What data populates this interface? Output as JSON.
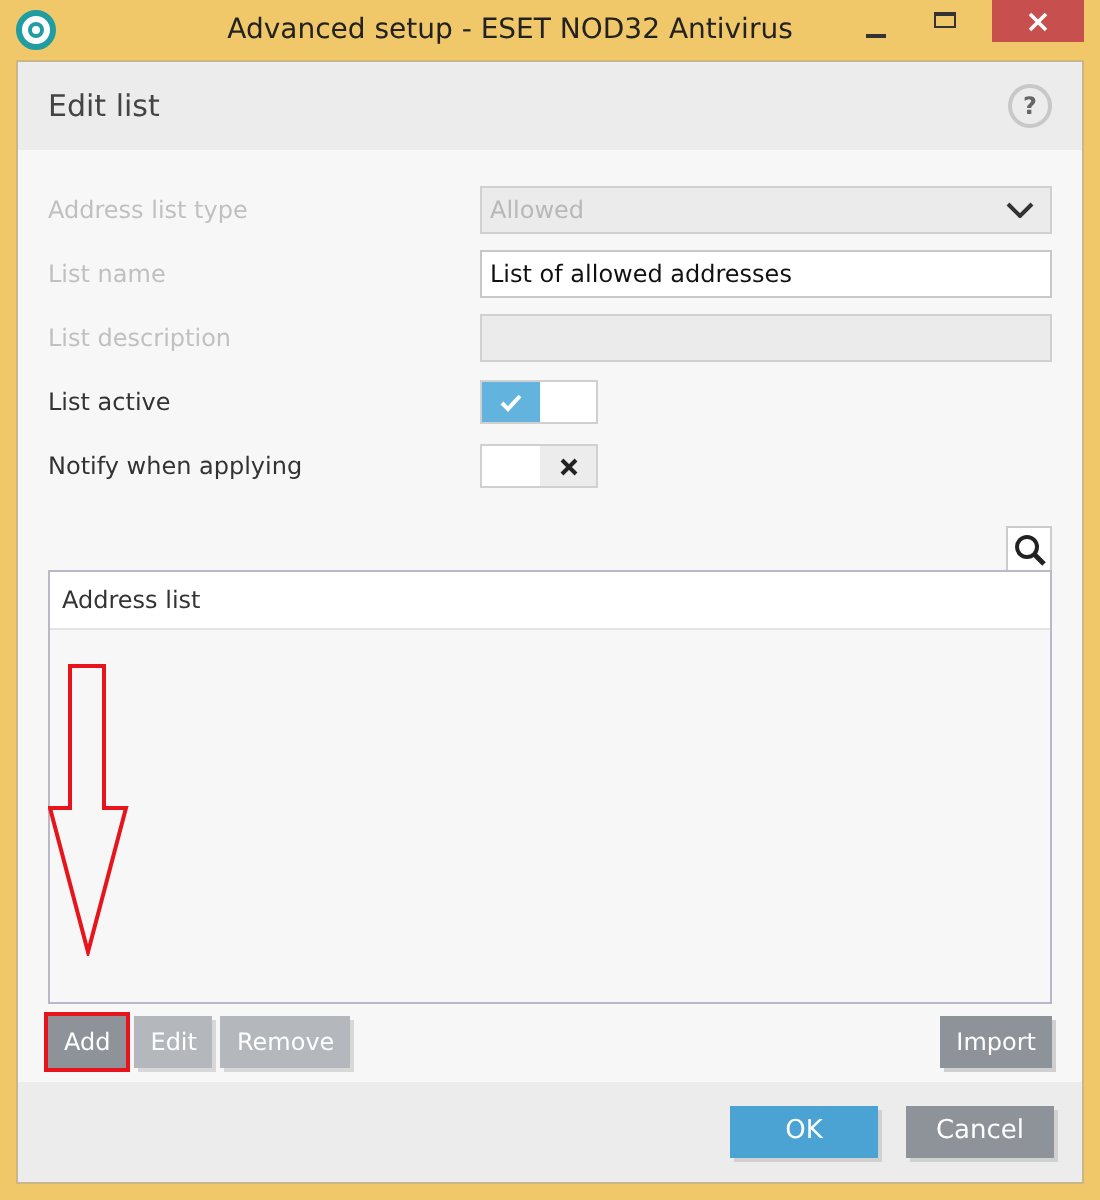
{
  "window": {
    "title": "Advanced setup - ESET NOD32 Antivirus"
  },
  "header": {
    "title": "Edit list",
    "help": "?"
  },
  "fields": [
    {
      "kind": "dropdown",
      "label": "Address list type",
      "value": "Allowed",
      "disabled": true
    },
    {
      "kind": "text",
      "label": "List name",
      "value": "List of allowed addresses",
      "disabled": false,
      "label_dimmed": true
    },
    {
      "kind": "text",
      "label": "List description",
      "disabled": true
    },
    {
      "kind": "toggle",
      "label": "List active",
      "on": true,
      "disabled": false
    },
    {
      "kind": "toggle",
      "label": "Notify when applying",
      "on": false,
      "disabled": false
    }
  ],
  "table": {
    "columns": [
      "Address list"
    ]
  },
  "list_buttons": [
    {
      "label": "Add",
      "disabled": false,
      "highlighted": true
    },
    {
      "label": "Edit",
      "disabled": true,
      "highlighted": false
    },
    {
      "label": "Remove",
      "disabled": true,
      "highlighted": false
    }
  ],
  "import_button": {
    "label": "Import"
  },
  "footer_buttons": [
    {
      "label": "OK",
      "kind": "primary"
    },
    {
      "label": "Cancel",
      "kind": "secondary"
    }
  ]
}
